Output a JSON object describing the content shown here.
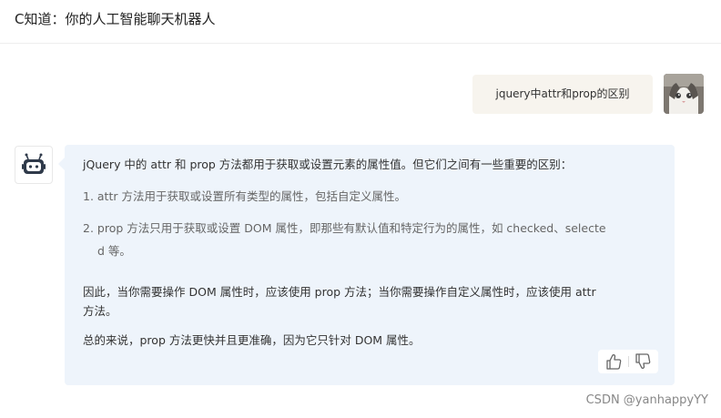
{
  "header": {
    "title": "C知道：你的人工智能聊天机器人"
  },
  "user_message": {
    "text": "jquery中attr和prop的区别"
  },
  "bot_message": {
    "intro": "jQuery 中的 attr 和 prop 方法都用于获取或设置元素的属性值。但它们之间有一些重要的区别：",
    "items": [
      "1. attr 方法用于获取或设置所有类型的属性，包括自定义属性。",
      "2. prop 方法只用于获取或设置 DOM 属性，即那些有默认值和特定行为的属性，如 checked、selecte",
      "d 等。"
    ],
    "conclusion_line1": "因此，当你需要操作 DOM 属性时，应该使用 prop 方法；当你需要操作自定义属性时，应该使用 attr",
    "conclusion_line2": "方法。",
    "summary": "总的来说，prop 方法更快并且更准确，因为它只针对 DOM 属性。"
  },
  "feedback": {
    "up_icon": "thumbs-up-icon",
    "down_icon": "thumbs-down-icon"
  },
  "watermark": "CSDN @yanhappyYY",
  "colors": {
    "bot_bubble": "#eef4fb",
    "user_bubble": "#f7f4ee"
  }
}
